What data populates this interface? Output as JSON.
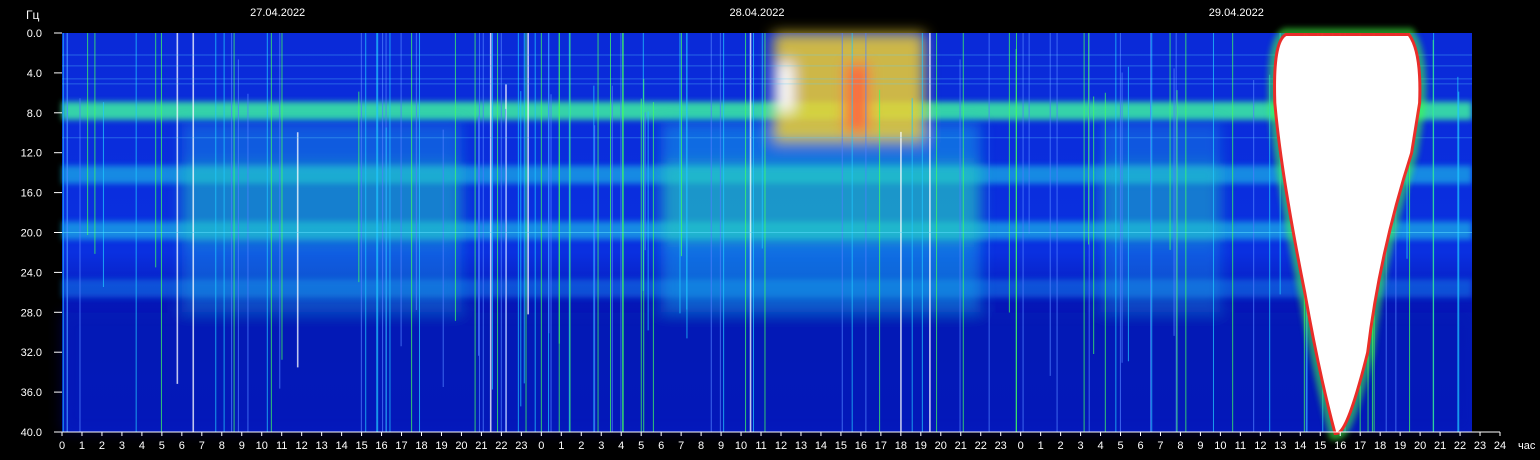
{
  "chart_data": {
    "type": "heatmap",
    "y_unit": "Гц",
    "x_unit": "час",
    "y_ticks": [
      "0.0",
      "4.0",
      "8.0",
      "12.0",
      "16.0",
      "20.0",
      "24.0",
      "28.0",
      "32.0",
      "36.0",
      "40.0"
    ],
    "ylim": [
      40,
      0
    ],
    "x_ticks": [
      "0",
      "1",
      "2",
      "3",
      "4",
      "5",
      "6",
      "7",
      "8",
      "9",
      "10",
      "11",
      "12",
      "13",
      "14",
      "15",
      "16",
      "17",
      "18",
      "19",
      "20",
      "21",
      "22",
      "23",
      "0",
      "1",
      "2",
      "3",
      "4",
      "5",
      "6",
      "7",
      "8",
      "9",
      "10",
      "11",
      "12",
      "13",
      "14",
      "15",
      "16",
      "17",
      "18",
      "19",
      "20",
      "21",
      "22",
      "23",
      "0",
      "1",
      "2",
      "3",
      "4",
      "5",
      "6",
      "7",
      "8",
      "9",
      "10",
      "11",
      "12",
      "13",
      "14",
      "15",
      "16",
      "17",
      "18",
      "19",
      "20",
      "21",
      "22",
      "23",
      "24"
    ],
    "dates": [
      {
        "label": "27.04.2022",
        "hour": 12
      },
      {
        "label": "28.04.2022",
        "hour": 36
      },
      {
        "label": "29.04.2022",
        "hour": 60
      }
    ],
    "data_end_hour": 70.6,
    "resonance_bands_hz": [
      7.8,
      14.2,
      19.8,
      25.6
    ],
    "colors": {
      "low": "#0010c8",
      "mid": "#00c8ff",
      "high": "#40ff40",
      "peak": "#ff2020",
      "saturated": "#ffffff"
    }
  }
}
